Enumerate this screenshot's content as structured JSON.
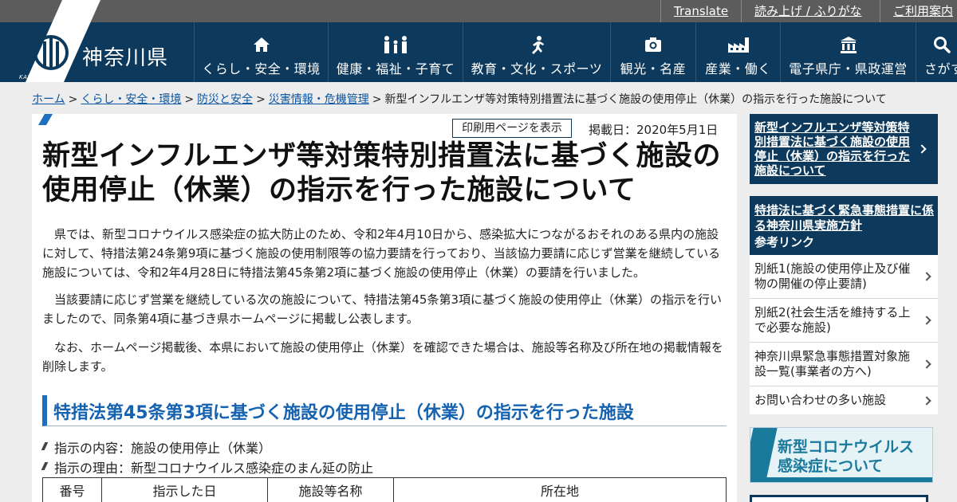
{
  "utility_links": [
    "Translate",
    "読み上げ / ふりがな",
    "ご利用案内"
  ],
  "header": {
    "site_name": "神奈川県",
    "logo_sub": "KANAGAWA"
  },
  "nav": [
    {
      "label": "くらし・安全・環境",
      "icon": "home-icon"
    },
    {
      "label": "健康・福祉・子育て",
      "icon": "family-icon"
    },
    {
      "label": "教育・文化・スポーツ",
      "icon": "runner-icon"
    },
    {
      "label": "観光・名産",
      "icon": "camera-icon"
    },
    {
      "label": "産業・働く",
      "icon": "factory-icon"
    },
    {
      "label": "電子県庁・県政運営",
      "icon": "government-building-icon"
    },
    {
      "label": "さがす",
      "icon": "search-icon"
    }
  ],
  "breadcrumb": {
    "links": [
      "ホーム",
      "くらし・安全・環境",
      "防災と安全",
      "災害情報・危機管理"
    ],
    "current": "新型インフルエンザ等対策特別措置法に基づく施設の使用停止（休業）の指示を行った施設について"
  },
  "main": {
    "print_label": "印刷用ページを表示",
    "published": "掲載日：2020年5月1日",
    "title": "新型インフルエンザ等対策特別措置法に基づく施設の使用停止（休業）の指示を行った施設について",
    "paragraphs": [
      "県では、新型コロナウイルス感染症の拡大防止のため、令和2年4月10日から、感染拡大につながるおそれのある県内の施設に対して、特措法第24条第9項に基づく施設の使用制限等の協力要請を行っており、当該協力要請に応じず営業を継続している施設については、令和2年4月28日に特措法第45条第2項に基づく施設の使用停止（休業）の要請を行いました。",
      "当該要請に応じず営業を継続している次の施設について、特措法第45条第3項に基づく施設の使用停止（休業）の指示を行いましたので、同条第4項に基づき県ホームページに掲載し公表します。",
      "なお、ホームページ掲載後、本県において施設の使用停止（休業）を確認できた場合は、施設等名称及び所在地の掲載情報を削除します。"
    ],
    "section_heading": "特措法第45条第3項に基づく施設の使用停止（休業）の指示を行った施設",
    "bullets": [
      "指示の内容：施設の使用停止（休業）",
      "指示の理由：新型コロナウイルス感染症のまん延の防止"
    ],
    "table_headers": [
      "番号",
      "指示した日",
      "施設等名称",
      "所在地"
    ]
  },
  "sidebar": {
    "current_page": "新型インフルエンザ等対策特別措置法に基づく施設の使用停止（休業）の指示を行った施設について",
    "box_title": "特措法に基づく緊急事態措置に係る神奈川県実施方針",
    "box_subtitle": "参考リンク",
    "links": [
      "別紙1(施設の使用停止及び催物の開催の停止要請)",
      "別紙2(社会生活を維持する上で必要な施設)",
      "神奈川県緊急事態措置対象施設一覧(事業者の方へ)",
      "お問い合わせの多い施設"
    ],
    "banner": "新型コロナウイルス感染症について"
  },
  "colors": {
    "header_bg": "#0d3a5c",
    "utility_bg": "#5c5c5c",
    "link": "#0b56a3",
    "section_accent": "#1562b0",
    "banner_accent": "#1a7a9b"
  }
}
